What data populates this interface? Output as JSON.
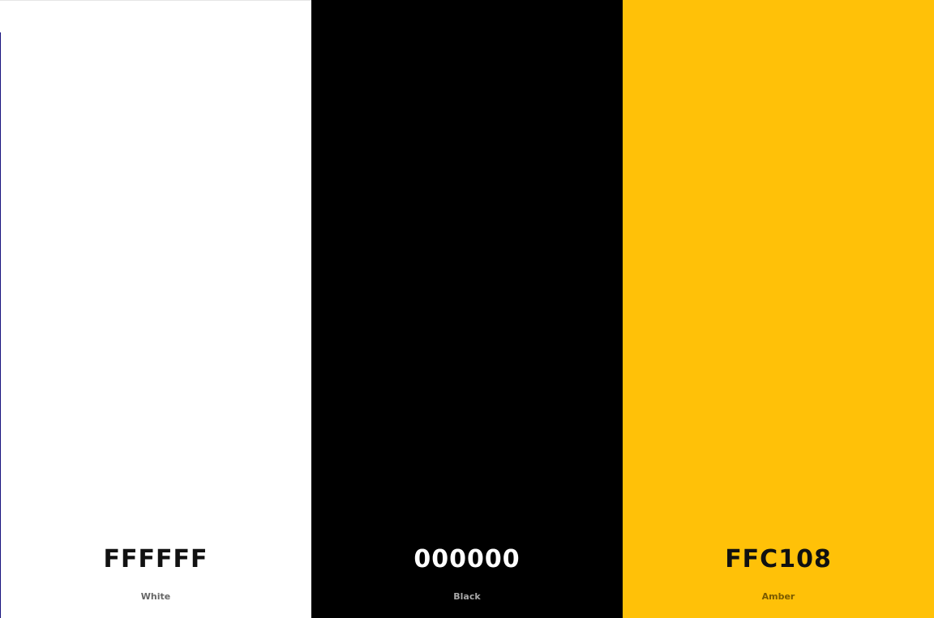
{
  "swatches": [
    {
      "hex": "FFFFFF",
      "name": "White",
      "color": "#FFFFFF",
      "text_color": "#111111",
      "name_color": "#666666"
    },
    {
      "hex": "000000",
      "name": "Black",
      "color": "#000000",
      "text_color": "#FFFFFF",
      "name_color": "#A8A8A8"
    },
    {
      "hex": "FFC108",
      "name": "Amber",
      "color": "#FFC108",
      "text_color": "#111111",
      "name_color": "#7A5A00"
    }
  ]
}
